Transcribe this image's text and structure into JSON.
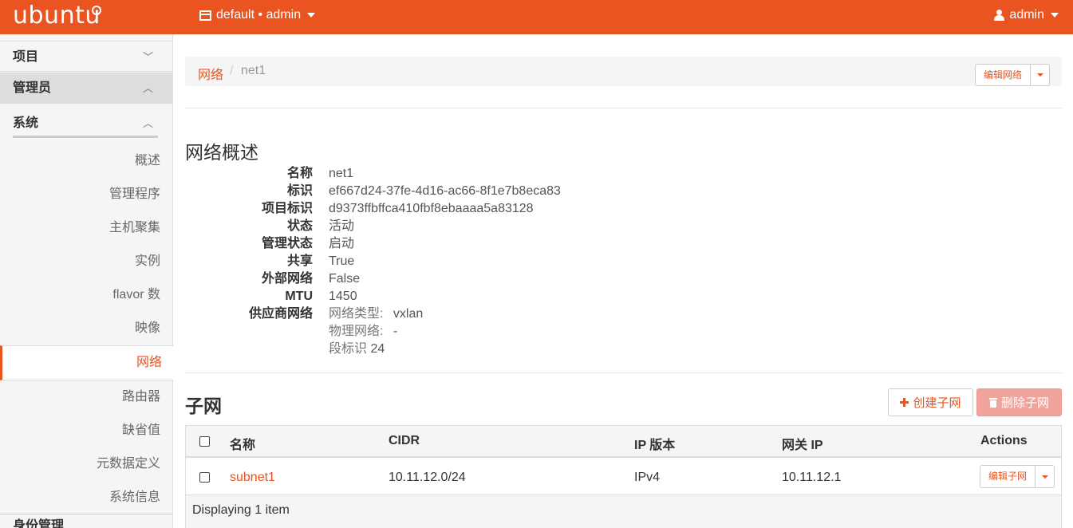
{
  "header": {
    "logo_text": "ubuntu",
    "project_menu": "default • admin",
    "user_menu": "admin"
  },
  "sidebar": {
    "sections": [
      "项目",
      "管理员",
      "系统"
    ],
    "items": [
      "概述",
      "管理程序",
      "主机聚集",
      "实例",
      "flavor 数",
      "映像",
      "网络",
      "路由器",
      "缺省值",
      "元数据定义",
      "系统信息"
    ],
    "active_item": "网络",
    "bottom_section": "身份管理"
  },
  "breadcrumb": {
    "parent": "网络",
    "separator": "/",
    "current": "net1"
  },
  "actions": {
    "edit_network": "编辑网络"
  },
  "overview": {
    "title": "网络概述",
    "fields": [
      {
        "label": "名称",
        "value": "net1"
      },
      {
        "label": "标识",
        "value": "ef667d24-37fe-4d16-ac66-8f1e7b8eca83"
      },
      {
        "label": "项目标识",
        "value": "d9373ffbffca410fbf8ebaaaa5a83128"
      },
      {
        "label": "状态",
        "value": "活动"
      },
      {
        "label": "管理状态",
        "value": "启动"
      },
      {
        "label": "共享",
        "value": "True"
      },
      {
        "label": "外部网络",
        "value": "False"
      },
      {
        "label": "MTU",
        "value": "1450"
      },
      {
        "label": "供应商网络",
        "value": ""
      }
    ],
    "provider": {
      "network_type_label": "网络类型:",
      "network_type_value": "vxlan",
      "physical_network_label": "物理网络:",
      "physical_network_value": "-",
      "segment_label": "段标识",
      "segment_value": "24"
    }
  },
  "subnets": {
    "title": "子网",
    "create_button": "创建子网",
    "delete_button": "删除子网",
    "columns": [
      "名称",
      "CIDR",
      "IP 版本",
      "网关 IP",
      "Actions"
    ],
    "rows": [
      {
        "name": "subnet1",
        "cidr": "10.11.12.0/24",
        "ip_version": "IPv4",
        "gateway": "10.11.12.1",
        "action": "编辑子网"
      }
    ],
    "footer": "Displaying 1 item"
  }
}
